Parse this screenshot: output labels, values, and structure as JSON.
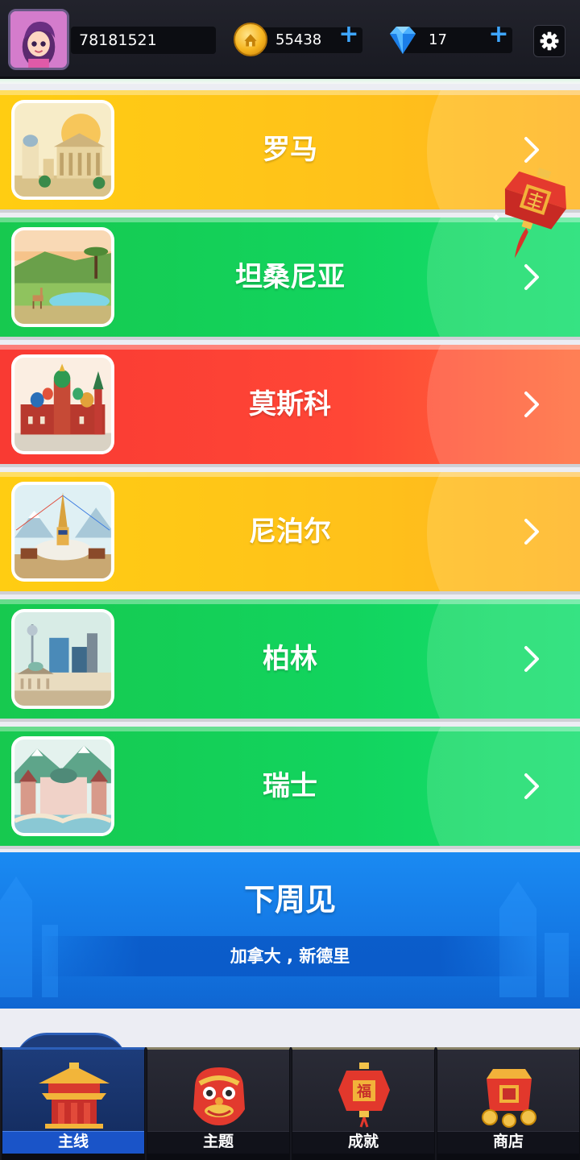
{
  "header": {
    "player_id": "78181521",
    "coins": "55438",
    "gems": "17",
    "icons": {
      "avatar": "player-avatar",
      "coin": "coin-icon",
      "gem": "diamond-icon",
      "add": "plus-icon",
      "settings": "gear-icon"
    }
  },
  "cities": [
    {
      "name": "罗马",
      "color": "yellow",
      "thumbnail": "rome-icon"
    },
    {
      "name": "坦桑尼亚",
      "color": "green",
      "thumbnail": "tanzania-icon"
    },
    {
      "name": "莫斯科",
      "color": "red",
      "thumbnail": "moscow-icon"
    },
    {
      "name": "尼泊尔",
      "color": "yellow",
      "thumbnail": "nepal-icon"
    },
    {
      "name": "柏林",
      "color": "green",
      "thumbnail": "berlin-icon"
    },
    {
      "name": "瑞士",
      "color": "green",
      "thumbnail": "switzerland-icon"
    }
  ],
  "upcoming": {
    "title": "下周见",
    "subtitle": "加拿大 , 新德里"
  },
  "nav": {
    "tabs": [
      {
        "label": "主线",
        "icon": "pagoda-icon",
        "active": true
      },
      {
        "label": "主题",
        "icon": "lion-dance-icon",
        "active": false
      },
      {
        "label": "成就",
        "icon": "fu-lantern-icon",
        "active": false
      },
      {
        "label": "商店",
        "icon": "treasure-gift-icon",
        "active": false
      }
    ]
  },
  "colors": {
    "yellow": "#ffc21a",
    "green": "#12d45e",
    "red": "#ff4636",
    "banner_blue": "#1478e4",
    "nav_active": "#1a54c8"
  }
}
